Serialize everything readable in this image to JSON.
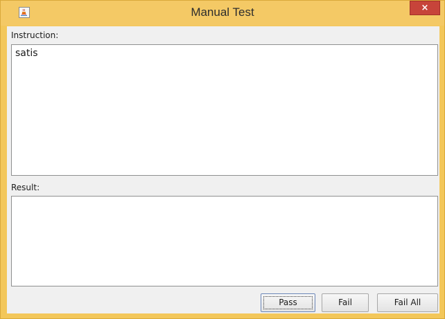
{
  "window": {
    "title": "Manual Test",
    "close_label": "×",
    "app_icon": "java-cup-icon"
  },
  "instruction": {
    "label": "Instruction:",
    "text": "satis"
  },
  "result": {
    "label": "Result:",
    "text": ""
  },
  "buttons": {
    "pass_label": "Pass",
    "fail_label": "Fail",
    "fail_all_label": "Fail All"
  }
}
